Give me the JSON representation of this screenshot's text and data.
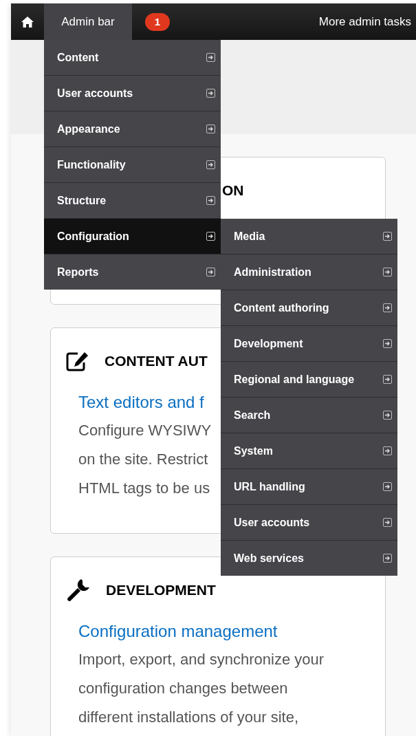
{
  "toolbar": {
    "tabs": [
      {
        "label": "Admin bar",
        "selected": true
      }
    ],
    "badge": "1",
    "more": "More admin tasks"
  },
  "menu": {
    "items": [
      {
        "label": "Content",
        "selected": false
      },
      {
        "label": "User accounts",
        "selected": false
      },
      {
        "label": "Appearance",
        "selected": false
      },
      {
        "label": "Functionality",
        "selected": false
      },
      {
        "label": "Structure",
        "selected": false
      },
      {
        "label": "Configuration",
        "selected": true
      },
      {
        "label": "Reports",
        "selected": false
      }
    ]
  },
  "submenu": {
    "items": [
      {
        "label": "Media"
      },
      {
        "label": "Administration"
      },
      {
        "label": "Content authoring"
      },
      {
        "label": "Development"
      },
      {
        "label": "Regional and language"
      },
      {
        "label": "Search"
      },
      {
        "label": "System"
      },
      {
        "label": "URL handling"
      },
      {
        "label": "User accounts"
      },
      {
        "label": "Web services"
      }
    ]
  },
  "cards": [
    {
      "kind": "covered",
      "title": "ON"
    },
    {
      "kind": "pencil",
      "title": "CONTENT AUT",
      "link": "Text editors and f",
      "lines": [
        "Configure WYSIWY",
        "on the site. Restrict",
        "HTML tags to be us"
      ]
    },
    {
      "kind": "wrench",
      "title": "DEVELOPMENT",
      "link": "Configuration management",
      "lines": [
        "Import, export, and synchronize your",
        "configuration changes between",
        "different installations of your site,"
      ]
    }
  ]
}
